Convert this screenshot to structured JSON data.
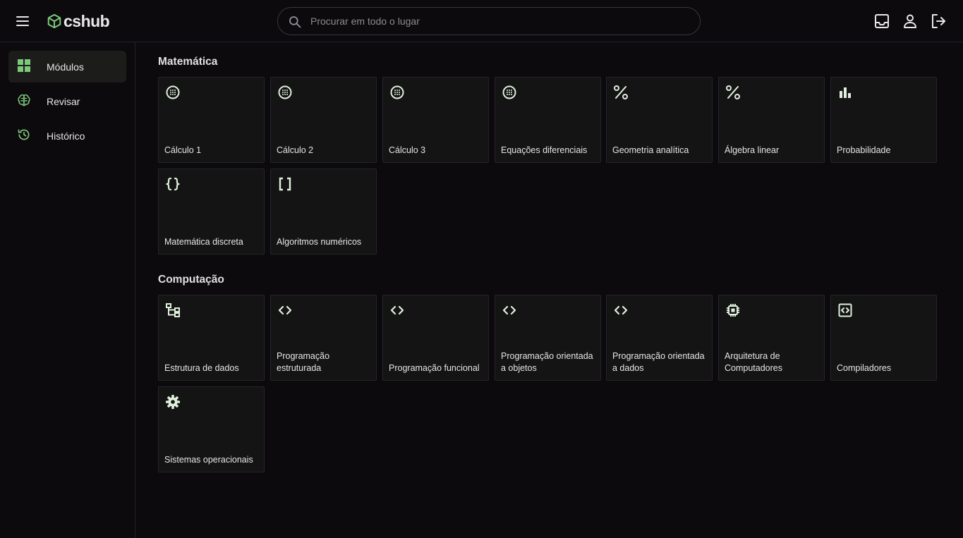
{
  "header": {
    "logo_text": "cshub",
    "search_placeholder": "Procurar em todo o lugar",
    "icons": [
      "menu-icon",
      "inbox-icon",
      "user-icon",
      "logout-icon"
    ]
  },
  "sidebar": {
    "items": [
      {
        "label": "Módulos",
        "icon": "grid-icon",
        "active": true
      },
      {
        "label": "Revisar",
        "icon": "brain-icon",
        "active": false
      },
      {
        "label": "Histórico",
        "icon": "history-icon",
        "active": false
      }
    ]
  },
  "sections": [
    {
      "title": "Matemática",
      "cards": [
        {
          "label": "Cálculo 1",
          "icon": "globe-grid-icon"
        },
        {
          "label": "Cálculo 2",
          "icon": "globe-grid-icon"
        },
        {
          "label": "Cálculo 3",
          "icon": "globe-grid-icon"
        },
        {
          "label": "Equações diferenciais",
          "icon": "globe-grid-icon"
        },
        {
          "label": "Geometria analítica",
          "icon": "vector-percent-icon"
        },
        {
          "label": "Álgebra linear",
          "icon": "vector-percent-icon"
        },
        {
          "label": "Probabilidade",
          "icon": "bar-chart-icon"
        },
        {
          "label": "Matemática discreta",
          "icon": "curly-braces-icon"
        },
        {
          "label": "Algoritmos numéricos",
          "icon": "square-brackets-icon"
        }
      ]
    },
    {
      "title": "Computação",
      "cards": [
        {
          "label": "Estrutura de dados",
          "icon": "tree-structure-icon"
        },
        {
          "label": "Programação estruturada",
          "icon": "code-icon"
        },
        {
          "label": "Programação funcional",
          "icon": "code-icon"
        },
        {
          "label": "Programação orientada a objetos",
          "icon": "code-icon"
        },
        {
          "label": "Programação orientada a dados",
          "icon": "code-icon"
        },
        {
          "label": "Arquitetura de Computadores",
          "icon": "chip-icon"
        },
        {
          "label": "Compiladores",
          "icon": "code-box-icon"
        },
        {
          "label": "Sistemas operacionais",
          "icon": "gear-icon"
        }
      ]
    }
  ],
  "colors": {
    "background": "#0c0a0d",
    "card": "#141414",
    "accent": "#7dc97a",
    "icon_light": "#dff0dc"
  }
}
